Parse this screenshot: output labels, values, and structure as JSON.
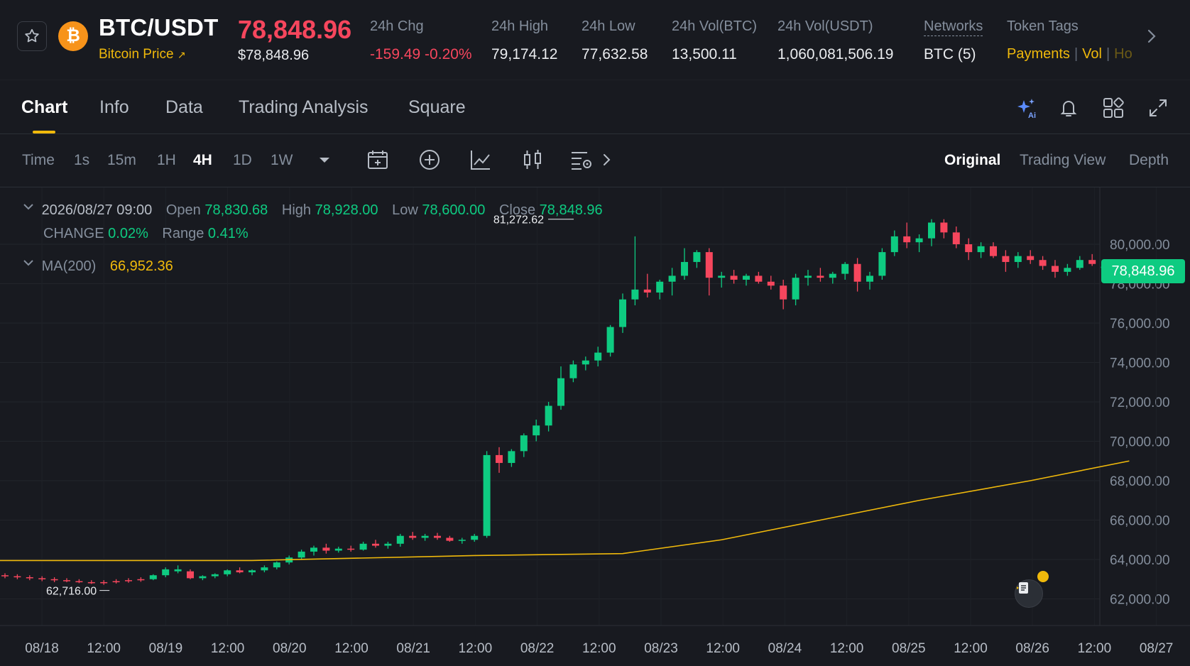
{
  "ticker": {
    "pair": "BTC/USDT",
    "coin_link": "Bitcoin Price",
    "last_price": "78,848.96",
    "last_price_usd": "$78,848.96",
    "stats": [
      {
        "label": "24h Chg",
        "value": "-159.49 -0.20%"
      },
      {
        "label": "24h High",
        "value": "79,174.12"
      },
      {
        "label": "24h Low",
        "value": "77,632.58"
      },
      {
        "label": "24h Vol(BTC)",
        "value": "13,500.11"
      },
      {
        "label": "24h Vol(USDT)",
        "value": "1,060,081,506.19"
      },
      {
        "label": "Networks",
        "value": "BTC (5)"
      }
    ],
    "token_tags_label": "Token Tags",
    "token_tags": [
      "Payments",
      "Vol",
      "Ho"
    ]
  },
  "tabs": [
    "Chart",
    "Info",
    "Data",
    "Trading Analysis",
    "Square"
  ],
  "toolbar": {
    "timeframes": [
      "Time",
      "1s",
      "15m",
      "1H",
      "4H",
      "1D",
      "1W"
    ],
    "active_timeframe": "4H",
    "views": [
      "Original",
      "Trading View",
      "Depth"
    ],
    "active_view": "Original"
  },
  "ohlc": {
    "date": "2026/08/27 09:00",
    "open_label": "Open",
    "open": "78,830.68",
    "high_label": "High",
    "high": "78,928.00",
    "low_label": "Low",
    "low": "78,600.00",
    "close_label": "Close",
    "close": "78,848.96",
    "change_label": "CHANGE",
    "change": "0.02%",
    "range_label": "Range",
    "range": "0.41%",
    "ma_label": "MA(200)",
    "ma": "66,952.36"
  },
  "colors": {
    "up": "#0ecb81",
    "down": "#f6465d",
    "ma": "#f0b90b",
    "accent": "#f0b90b"
  },
  "chart_data": {
    "type": "candlestick",
    "interval": "4H",
    "y_ticks": [
      62000,
      64000,
      66000,
      68000,
      70000,
      72000,
      74000,
      76000,
      78000,
      80000
    ],
    "y_tick_labels": [
      "62,000.00",
      "64,000.00",
      "66,000.00",
      "68,000.00",
      "70,000.00",
      "72,000.00",
      "74,000.00",
      "76,000.00",
      "78,000.00",
      "80,000.00"
    ],
    "ylim": [
      61000,
      83600
    ],
    "x_labels": [
      "08/18",
      "12:00",
      "08/19",
      "12:00",
      "08/20",
      "12:00",
      "08/21",
      "12:00",
      "08/22",
      "12:00",
      "08/23",
      "12:00",
      "08/24",
      "12:00",
      "08/25",
      "12:00",
      "08/26",
      "12:00",
      "08/27"
    ],
    "x_label_slots": [
      1.7,
      4.7,
      7.7,
      10.7,
      13.7,
      16.7,
      19.7,
      22.7,
      25.7,
      28.7,
      31.7,
      34.7,
      37.7,
      40.7,
      43.7,
      46.7,
      49.7,
      52.7,
      55.7
    ],
    "current_price": 78848.96,
    "current_price_label": "78,848.96",
    "max_label": "81,272.62",
    "max_index": 45,
    "min_label": "62,716.00",
    "min_index": 8,
    "candles": [
      [
        0,
        63200,
        63300,
        63050,
        63150
      ],
      [
        0,
        63150,
        63250,
        63000,
        63100
      ],
      [
        0,
        63100,
        63200,
        62950,
        63050
      ],
      [
        0,
        63050,
        63150,
        62900,
        63000
      ],
      [
        0,
        63000,
        63100,
        62850,
        62950
      ],
      [
        0,
        62950,
        63050,
        62850,
        62900
      ],
      [
        0,
        62900,
        63000,
        62800,
        62850
      ],
      [
        0,
        62850,
        62950,
        62760,
        62800
      ],
      [
        0,
        62800,
        62950,
        62716,
        62850
      ],
      [
        0,
        62850,
        63000,
        62780,
        62900
      ],
      [
        0,
        62900,
        63050,
        62820,
        62950
      ],
      [
        0,
        62950,
        63100,
        62870,
        63000
      ],
      [
        1,
        63000,
        63250,
        62950,
        63200
      ],
      [
        1,
        63200,
        63600,
        63100,
        63500
      ],
      [
        1,
        63500,
        63700,
        63300,
        63400
      ],
      [
        0,
        63400,
        63500,
        63000,
        63050
      ],
      [
        1,
        63050,
        63200,
        62950,
        63150
      ],
      [
        1,
        63150,
        63300,
        63050,
        63250
      ],
      [
        1,
        63250,
        63500,
        63150,
        63450
      ],
      [
        0,
        63450,
        63600,
        63300,
        63350
      ],
      [
        1,
        63350,
        63500,
        63200,
        63450
      ],
      [
        1,
        63450,
        63700,
        63350,
        63600
      ],
      [
        1,
        63600,
        63900,
        63500,
        63850
      ],
      [
        1,
        63850,
        64200,
        63750,
        64100
      ],
      [
        1,
        64100,
        64500,
        64000,
        64400
      ],
      [
        1,
        64400,
        64700,
        64200,
        64600
      ],
      [
        0,
        64600,
        64800,
        64300,
        64450
      ],
      [
        1,
        64450,
        64650,
        64350,
        64550
      ],
      [
        0,
        64550,
        64700,
        64400,
        64500
      ],
      [
        1,
        64500,
        64900,
        64450,
        64800
      ],
      [
        0,
        64800,
        65000,
        64600,
        64700
      ],
      [
        1,
        64700,
        64900,
        64550,
        64800
      ],
      [
        1,
        64800,
        65300,
        64650,
        65200
      ],
      [
        0,
        65200,
        65400,
        65000,
        65100
      ],
      [
        1,
        65100,
        65300,
        64950,
        65200
      ],
      [
        0,
        65200,
        65350,
        65000,
        65100
      ],
      [
        0,
        65100,
        65200,
        64900,
        64950
      ],
      [
        1,
        64950,
        65100,
        64800,
        65000
      ],
      [
        1,
        65000,
        65300,
        64900,
        65200
      ],
      [
        1,
        65200,
        69500,
        65100,
        69300
      ],
      [
        0,
        69300,
        69700,
        68400,
        68900
      ],
      [
        1,
        68900,
        69600,
        68700,
        69500
      ],
      [
        1,
        69500,
        70400,
        69200,
        70300
      ],
      [
        1,
        70300,
        71100,
        70000,
        70800
      ],
      [
        1,
        70800,
        72000,
        70500,
        71800
      ],
      [
        1,
        71800,
        73800,
        71600,
        73200
      ],
      [
        1,
        73200,
        74100,
        73000,
        73900
      ],
      [
        1,
        73900,
        74300,
        73600,
        74100
      ],
      [
        1,
        74100,
        74800,
        73800,
        74500
      ],
      [
        1,
        74500,
        75900,
        74300,
        75800
      ],
      [
        1,
        75800,
        77500,
        75500,
        77200
      ],
      [
        1,
        77200,
        80400,
        76900,
        77700
      ],
      [
        0,
        77700,
        78500,
        77300,
        77550
      ],
      [
        1,
        77550,
        78200,
        77200,
        78100
      ],
      [
        1,
        78100,
        78800,
        77400,
        78400
      ],
      [
        1,
        78400,
        79800,
        78200,
        79100
      ],
      [
        1,
        79100,
        79700,
        78800,
        79600
      ],
      [
        0,
        79600,
        79800,
        77400,
        78300
      ],
      [
        1,
        78300,
        78600,
        77800,
        78400
      ],
      [
        0,
        78400,
        78700,
        78000,
        78200
      ],
      [
        1,
        78200,
        78500,
        77900,
        78400
      ],
      [
        0,
        78400,
        78600,
        78000,
        78100
      ],
      [
        0,
        78100,
        78400,
        77700,
        77900
      ],
      [
        0,
        77900,
        78200,
        76700,
        77200
      ],
      [
        1,
        77200,
        78500,
        76900,
        78300
      ],
      [
        1,
        78300,
        78700,
        77900,
        78400
      ],
      [
        0,
        78400,
        78800,
        78100,
        78300
      ],
      [
        1,
        78300,
        78600,
        78000,
        78500
      ],
      [
        1,
        78500,
        79100,
        78200,
        79000
      ],
      [
        0,
        79000,
        79300,
        77600,
        78100
      ],
      [
        1,
        78100,
        78600,
        77700,
        78400
      ],
      [
        1,
        78400,
        79800,
        78200,
        79600
      ],
      [
        1,
        79600,
        80700,
        79400,
        80400
      ],
      [
        0,
        80400,
        81100,
        79800,
        80100
      ],
      [
        1,
        80100,
        80500,
        79600,
        80300
      ],
      [
        1,
        80300,
        81272,
        79900,
        81100
      ],
      [
        0,
        81100,
        81272,
        80300,
        80600
      ],
      [
        0,
        80600,
        80900,
        79800,
        80000
      ],
      [
        0,
        80000,
        80300,
        79200,
        79600
      ],
      [
        1,
        79600,
        80100,
        79300,
        79900
      ],
      [
        0,
        79900,
        80100,
        79300,
        79400
      ],
      [
        0,
        79400,
        79700,
        78600,
        79100
      ],
      [
        1,
        79100,
        79600,
        78800,
        79400
      ],
      [
        0,
        79400,
        79700,
        79000,
        79200
      ],
      [
        0,
        79200,
        79400,
        78700,
        78900
      ],
      [
        0,
        78900,
        79200,
        78300,
        78600
      ],
      [
        1,
        78600,
        79000,
        78400,
        78800
      ],
      [
        1,
        78800,
        79400,
        78700,
        79200
      ],
      [
        0,
        79200,
        79500,
        78900,
        79000
      ],
      [
        1,
        78830.68,
        78928,
        78600,
        78848.96
      ]
    ],
    "ma_line": [
      [
        0,
        63950
      ],
      [
        20,
        63950
      ],
      [
        38,
        64200
      ],
      [
        50,
        64300
      ],
      [
        58,
        65000
      ],
      [
        66,
        66000
      ],
      [
        74,
        67000
      ],
      [
        83,
        68000
      ],
      [
        91,
        69000
      ]
    ]
  }
}
